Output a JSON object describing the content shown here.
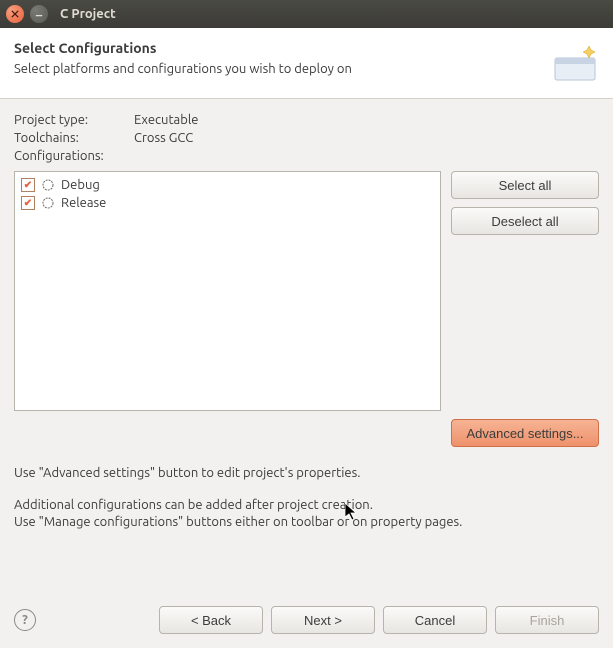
{
  "window": {
    "title": "C Project"
  },
  "header": {
    "title": "Select Configurations",
    "subtitle": "Select platforms and configurations you wish to deploy on"
  },
  "info": {
    "project_type_label": "Project type:",
    "project_type_value": "Executable",
    "toolchains_label": "Toolchains:",
    "toolchains_value": "Cross GCC",
    "configurations_label": "Configurations:"
  },
  "configurations": {
    "items": [
      {
        "label": "Debug",
        "checked": true
      },
      {
        "label": "Release",
        "checked": true
      }
    ]
  },
  "buttons": {
    "select_all": "Select all",
    "deselect_all": "Deselect all",
    "advanced": "Advanced settings..."
  },
  "notes": {
    "line1": "Use \"Advanced settings\" button to edit project's properties.",
    "line2": "Additional configurations can be added after project creation.",
    "line3": "Use \"Manage configurations\" buttons either on toolbar or on property pages."
  },
  "footer": {
    "back": "< Back",
    "next": "Next >",
    "cancel": "Cancel",
    "finish": "Finish"
  }
}
